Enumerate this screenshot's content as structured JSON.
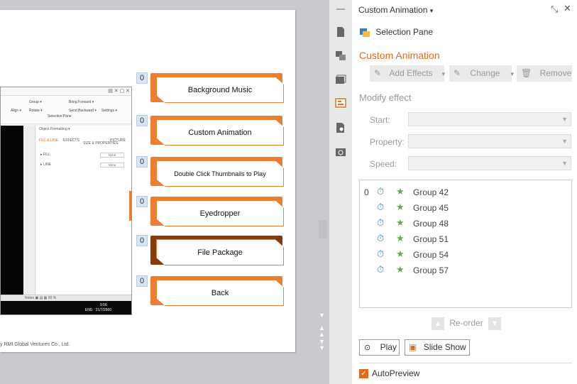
{
  "slide": {
    "credit": "y RMI Global Ventures Co., Ltd.",
    "screenshot": {
      "ribbon": [
        "Group ▾",
        "Bring Forward ▾",
        "Align ▾",
        "Rotate ▾",
        "Send Backward ▾",
        "Selection Pane",
        "Settings ▾"
      ],
      "pane_title": "Object Formatting ▾",
      "tabs": [
        "FILL & LINE",
        "EFFECTS",
        "SIZE & PROPERTIES",
        "PICTURE"
      ],
      "fill_label": "▸ FILL",
      "line_label": "▸ LINE",
      "fill_value": "None",
      "line_value": "None",
      "status": "Notes   ▣ ▤ ▦   90 %",
      "clock_time": "9:56",
      "clock_date": "21/7/2560",
      "lang": "ENG"
    },
    "buttons": [
      {
        "num": "0",
        "label": "Background Music",
        "color": "#ed7d31"
      },
      {
        "num": "0",
        "label": "Custom Animation",
        "color": "#ed7d31"
      },
      {
        "num": "0",
        "label": "Double Click Thumbnails to Play",
        "color": "#ed7d31"
      },
      {
        "num": "0",
        "label": "Eyedropper",
        "color": "#ed7d31"
      },
      {
        "num": "0",
        "label": "File Package",
        "color": "#843c0c"
      },
      {
        "num": "0",
        "label": "Back",
        "color": "#ed7d31"
      }
    ]
  },
  "rail": {
    "icons": [
      "menu-icon",
      "document-icon",
      "shapes-icon",
      "slide-layout-icon",
      "custom-animation-icon",
      "search-document-icon",
      "backup-icon"
    ],
    "scroll_icons": [
      "scroll-down-icon",
      "prev-page-icon",
      "next-page-icon"
    ]
  },
  "panel": {
    "title": "Custom Animation",
    "title_caret": "▾",
    "selection_pane": "Selection Pane",
    "section": "Custom Animation",
    "add_effects": "Add Effects",
    "change": "Change",
    "remove": "Remove",
    "modify": "Modify effect",
    "start_label": "Start:",
    "property_label": "Property:",
    "speed_label": "Speed:",
    "effects": [
      {
        "num": "0",
        "name": "Group 42"
      },
      {
        "num": "",
        "name": "Group 45"
      },
      {
        "num": "",
        "name": "Group 48"
      },
      {
        "num": "",
        "name": "Group 51"
      },
      {
        "num": "",
        "name": "Group 54"
      },
      {
        "num": "",
        "name": "Group 57"
      }
    ],
    "reorder": "Re-order",
    "play": "Play",
    "slide_show": "Slide Show",
    "autopreview": "AutoPreview"
  }
}
